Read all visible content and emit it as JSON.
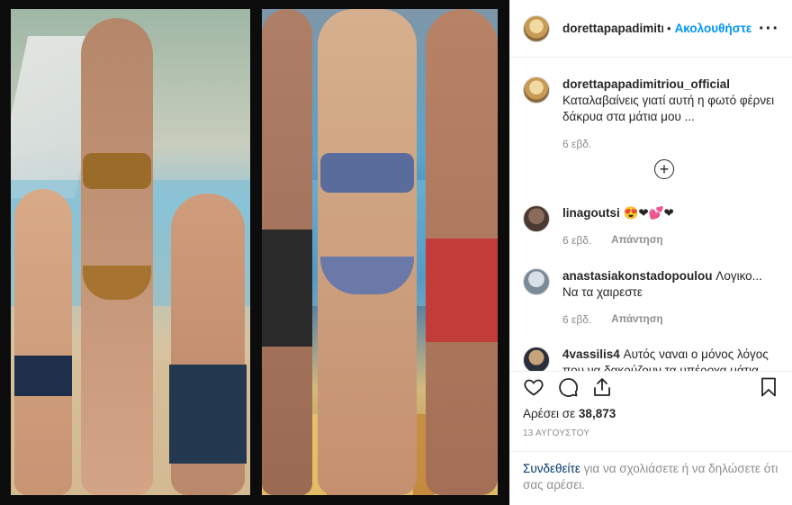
{
  "header": {
    "username": "dorettapapadimitriou_official",
    "separator": "•",
    "follow_label": "Ακολουθήστε",
    "more_label": "···"
  },
  "caption": {
    "username": "dorettapapadimitriou_official",
    "text": "Καταλαβαίνεις γιατί αυτή η φωτό φέρνει δάκρυα στα μάτια μου ...",
    "time": "6 εβδ.",
    "load_more_label": "+"
  },
  "comments": [
    {
      "username": "linagoutsi",
      "text": "😍❤💕❤",
      "time": "6 εβδ.",
      "reply_label": "Απάντηση"
    },
    {
      "username": "anastasiakonstadopoulou",
      "text": "Λογικο... Να τα χαιρεστε",
      "time": "6 εβδ.",
      "reply_label": "Απάντηση"
    },
    {
      "username": "4vassilis4",
      "text": "Αυτός ναναι ο μόνος λόγος που να δακρύζουν τα υπέροχα μάτια",
      "time": "",
      "reply_label": ""
    }
  ],
  "actions": {
    "like_icon": "heart-icon",
    "comment_icon": "comment-icon",
    "share_icon": "share-icon",
    "save_icon": "bookmark-icon"
  },
  "likes": {
    "prefix": "Αρέσει σε",
    "count": "38,873"
  },
  "date": "13 ΑΥΓΟΥΣΤΟΥ",
  "login_prompt": {
    "link": "Συνδεθείτε",
    "rest": " για να σχολιάσετε ή να δηλώσετε ότι σας αρέσει."
  }
}
